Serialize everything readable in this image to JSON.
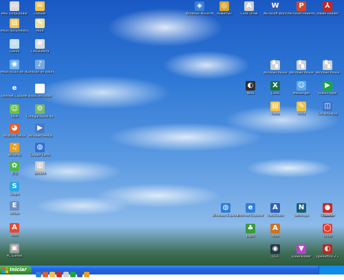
{
  "desktop": {
    "left_icons": [
      {
        "label": "Meu computador",
        "icon": "computer-icon",
        "color": "#d9d9d9",
        "glyph": "▭"
      },
      {
        "label": "Meus documentos",
        "icon": "folder-icon",
        "color": "#f1c24a",
        "glyph": "▤"
      },
      {
        "label": "Lixeira",
        "icon": "recycle-bin-icon",
        "color": "#bfe0f7",
        "glyph": "♲"
      },
      {
        "label": "Meus locais de rede",
        "icon": "network-icon",
        "color": "#6fb3ef",
        "glyph": "◉"
      },
      {
        "label": "Internet Explorer",
        "icon": "ie-icon",
        "color": "#2e7be0",
        "glyph": "e"
      },
      {
        "label": "MSN",
        "icon": "msn-icon",
        "color": "#6dbf4b",
        "glyph": "☺"
      },
      {
        "label": "Mozilla Firefox",
        "icon": "firefox-icon",
        "color": "#e0602a",
        "glyph": "◕"
      },
      {
        "label": "Winamp",
        "icon": "winamp-icon",
        "color": "#e8a020",
        "glyph": "♫"
      },
      {
        "label": "ICQ",
        "icon": "icq-icon",
        "color": "#4cb84a",
        "glyph": "✿"
      },
      {
        "label": "Skype",
        "icon": "skype-icon",
        "color": "#2aa7e1",
        "glyph": "S"
      },
      {
        "label": "eMule",
        "icon": "emule-icon",
        "color": "#6b8fc5",
        "glyph": "E"
      },
      {
        "label": "Ares",
        "icon": "ares-icon",
        "color": "#e84830",
        "glyph": "A"
      },
      {
        "label": "PC Games",
        "icon": "games-icon",
        "color": "#9e9e9e",
        "glyph": "▣"
      }
    ],
    "col2_icons": [
      {
        "label": "Outlook",
        "icon": "outlook-icon",
        "color": "#f3c14b",
        "glyph": "✉"
      },
      {
        "label": "Paint",
        "icon": "paint-icon",
        "color": "#e9e0a0",
        "glyph": "✎"
      },
      {
        "label": "Calculadora",
        "icon": "calculator-icon",
        "color": "#dcdcdc",
        "glyph": "#"
      },
      {
        "label": "Controle de volume",
        "icon": "volume-icon",
        "color": "#77a8e0",
        "glyph": "♪"
      },
      {
        "label": "Bloco de notas",
        "icon": "notepad-icon",
        "color": "#ffffff",
        "glyph": "≡"
      },
      {
        "label": "Configurações do Sistema",
        "icon": "settings-icon",
        "color": "#76b86a",
        "glyph": "⚙"
      },
      {
        "label": "Windows Media",
        "icon": "media-icon",
        "color": "#4a78c8",
        "glyph": "▶"
      },
      {
        "label": "Google Earth",
        "icon": "earth-icon",
        "color": "#2f6fd0",
        "glyph": "◍"
      },
      {
        "label": "WinRAR",
        "icon": "winrar-icon",
        "color": "#c8c8c8",
        "glyph": "▥"
      }
    ],
    "top_icons": [
      {
        "label": "Windows Movie Maker",
        "icon": "movie-maker-icon",
        "color": "#3a7fd5",
        "glyph": "◈"
      },
      {
        "label": "PowerISO",
        "icon": "poweriso-icon",
        "color": "#d8a52a",
        "glyph": "◎"
      },
      {
        "label": "Corel Draw",
        "icon": "corel-icon",
        "color": "#cfcfcf",
        "glyph": "A"
      },
      {
        "label": "Microsoft Word",
        "icon": "word-icon",
        "color": "#2b5cb8",
        "glyph": "W"
      },
      {
        "label": "Microsoft PowerPoint",
        "icon": "powerpoint-icon",
        "color": "#d24726",
        "glyph": "P"
      },
      {
        "label": "Adobe Reader",
        "icon": "adobe-reader-icon",
        "color": "#c8261d",
        "glyph": "⅄"
      }
    ],
    "right_icons": [
      {
        "label": "Windows Movie",
        "icon": "clapper-icon",
        "color": "#cfcfcf",
        "glyph": "▚"
      },
      {
        "label": "Windows Movie",
        "icon": "clapper-icon",
        "color": "#cfcfcf",
        "glyph": "▚"
      },
      {
        "label": "Windows Movie",
        "icon": "clapper-icon",
        "color": "#cfcfcf",
        "glyph": "▚"
      },
      {
        "label": "Nero",
        "icon": "nero-icon",
        "color": "#2e2e2e",
        "glyph": "◐"
      },
      {
        "label": "Excel",
        "icon": "excel-icon",
        "color": "#1e7145",
        "glyph": "X"
      },
      {
        "label": "Messenger",
        "icon": "messenger-icon",
        "color": "#59a7e8",
        "glyph": "☺"
      },
      {
        "label": "Pasta",
        "icon": "folder-icon",
        "color": "#f1c24a",
        "glyph": "▤"
      },
      {
        "label": "Paint",
        "icon": "paint-icon",
        "color": "#e9c24a",
        "glyph": "✎"
      },
      {
        "label": "Ferramentas",
        "icon": "tools-icon",
        "color": "#3f72c6",
        "glyph": "◫"
      },
      {
        "label": "Video Player",
        "icon": "player-icon",
        "color": "#1aa83a",
        "glyph": "▶"
      }
    ],
    "bottom_icons": [
      {
        "label": "Windows Explorer",
        "icon": "explorer-icon",
        "color": "#2f7ed8",
        "glyph": "◍"
      },
      {
        "label": "Internet Explorer",
        "icon": "ie-icon",
        "color": "#2f7ed8",
        "glyph": "e"
      },
      {
        "label": "AutoRoute",
        "icon": "autoroute-icon",
        "color": "#2f5fb8",
        "glyph": "A"
      },
      {
        "label": "Netscape",
        "icon": "netscape-icon",
        "color": "#17607b",
        "glyph": "N"
      },
      {
        "label": "Opera",
        "icon": "opera-icon",
        "color": "#d64f1a",
        "glyph": "O"
      },
      {
        "label": "Jogos",
        "icon": "game-icon",
        "color": "#3a9a3a",
        "glyph": "♣"
      },
      {
        "label": "Ares",
        "icon": "ares-icon",
        "color": "#d1731e",
        "glyph": "A"
      },
      {
        "label": "Orkut",
        "icon": "orkut-icon",
        "color": "#e64030",
        "glyph": "◯"
      },
      {
        "label": "Gravador",
        "icon": "recorder-icon",
        "color": "#d0281e",
        "glyph": "●"
      },
      {
        "label": "OCA",
        "icon": "steam-icon",
        "color": "#27354a",
        "glyph": "◉"
      },
      {
        "label": "iDownloader",
        "icon": "downloader-icon",
        "color": "#b743c8",
        "glyph": "▼"
      },
      {
        "label": "Openoffice 2.1",
        "icon": "openoffice-icon",
        "color": "#c0281e",
        "glyph": "◐"
      }
    ]
  },
  "taskbar": {
    "start_label": "Iniciar",
    "quick_launch_colors": [
      "#2f7ed8",
      "#e0602a",
      "#f1c24a",
      "#d0281e",
      "#d1d1d1",
      "#1aa83a",
      "#2b5cb8",
      "#e8a020"
    ],
    "tray_color": "#0f8ce9"
  }
}
